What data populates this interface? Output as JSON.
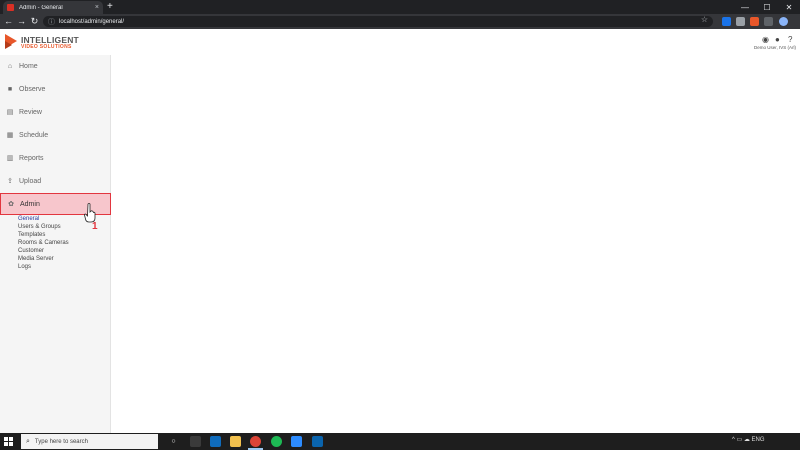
{
  "browser": {
    "tab_title": "Admin - General",
    "tab_close": "×",
    "new_tab": "+",
    "url": "localhost/admin/general/",
    "back": "←",
    "forward": "→",
    "reload": "↻",
    "info": "ⓘ",
    "star": "☆",
    "minimize": "—",
    "maximize": "☐",
    "close": "✕"
  },
  "header": {
    "logo_top": "INTELLIGENT",
    "logo_bottom": "VIDEO SOLUTIONS",
    "user_label": "Demo User, IVS (Arl)",
    "accent": "#e8572a"
  },
  "sidebar": {
    "items": [
      {
        "label": "Home",
        "icon": "home-icon",
        "glyph": "⌂"
      },
      {
        "label": "Observe",
        "icon": "camera-icon",
        "glyph": "■"
      },
      {
        "label": "Review",
        "icon": "review-icon",
        "glyph": "▤"
      },
      {
        "label": "Schedule",
        "icon": "calendar-icon",
        "glyph": "▦"
      },
      {
        "label": "Reports",
        "icon": "chart-icon",
        "glyph": "▥"
      },
      {
        "label": "Upload",
        "icon": "upload-icon",
        "glyph": "⇪"
      },
      {
        "label": "Admin",
        "icon": "gear-icon",
        "glyph": "✿"
      }
    ],
    "admin_sub": [
      "General",
      "Users & Groups",
      "Templates",
      "Rooms & Cameras",
      "Customer",
      "Media Server",
      "Logs"
    ],
    "active_color": "#f7c6cc",
    "active_border": "#e2363f"
  },
  "annotation": {
    "step": "1"
  },
  "taskbar": {
    "search_placeholder": "Type here to search",
    "search_glyph": "⌕",
    "task_view_glyph": "○",
    "tray_text": "^ ▭ ☁ ENG"
  }
}
